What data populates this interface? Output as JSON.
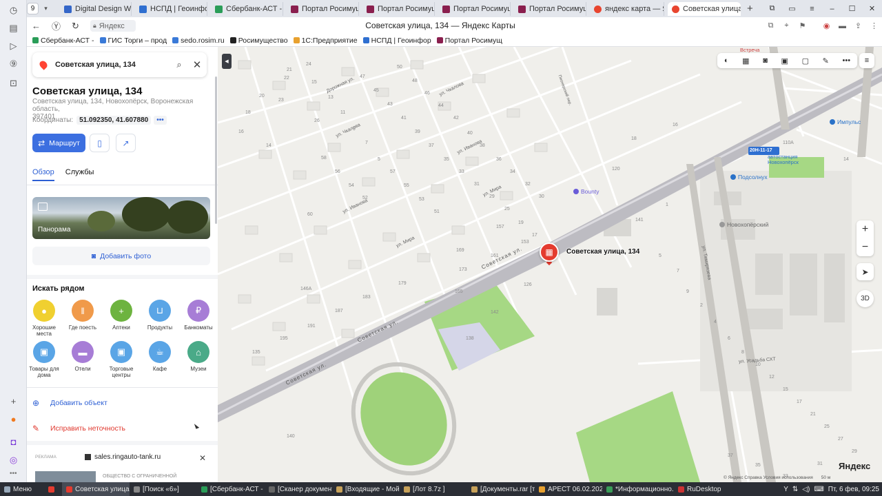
{
  "browser": {
    "tab_count": "9",
    "tabs": [
      {
        "title": "Digital Design Web С",
        "color": "#3466c8"
      },
      {
        "title": "НСПД | Геоинформ",
        "color": "#2f6fd0"
      },
      {
        "title": "Сбербанк-АСТ - Эл",
        "color": "#2a9d58"
      },
      {
        "title": "Портал Росимущес",
        "color": "#8a1f4e"
      },
      {
        "title": "Портал Росимущес",
        "color": "#8a1f4e"
      },
      {
        "title": "Портал Росимущес",
        "color": "#8a1f4e"
      },
      {
        "title": "Портал Росимущес",
        "color": "#8a1f4e"
      },
      {
        "title": "яндекс карта — Янд",
        "color": "#e8452f"
      },
      {
        "title": "Советская улица",
        "color": "#e8452f"
      }
    ],
    "url_host": "Яндекс",
    "page_title": "Советская улица, 134 — Яндекс Карты",
    "bookmarks": [
      {
        "label": "Сбербанк-АСТ -",
        "color": "#2a9d58"
      },
      {
        "label": "ГИС Торги – прод",
        "color": "#3a7ad8"
      },
      {
        "label": "sedo.rosim.ru",
        "color": "#3a7ad8"
      },
      {
        "label": "Росимущество",
        "color": "#222222"
      },
      {
        "label": "1С:Предприятие",
        "color": "#e8a12f"
      },
      {
        "label": "НСПД | Геоинфор",
        "color": "#2f6fd0"
      },
      {
        "label": "Портал Росимущ",
        "color": "#8a1f4e"
      }
    ]
  },
  "search": {
    "value": "Советская улица, 134"
  },
  "place": {
    "title": "Советская улица, 134",
    "address_line1": "Советская улица, 134, Новохопёрск, Воронежская область,",
    "address_line2": "397401",
    "coords_label": "Координаты:",
    "coords_value": "51.092350, 41.607880",
    "coords_more": "•••",
    "route_label": "Маршрут"
  },
  "tabs": {
    "overview": "Обзор",
    "services": "Службы"
  },
  "panorama_label": "Панорама",
  "add_photo_label": "Добавить фото",
  "nearby": {
    "title": "Искать рядом",
    "categories": [
      {
        "label": "Хорошие места",
        "color": "#f0d030",
        "icon": "pin-icon"
      },
      {
        "label": "Где поесть",
        "color": "#f09a4a",
        "icon": "fork-icon"
      },
      {
        "label": "Аптеки",
        "color": "#6db33f",
        "icon": "plus-icon"
      },
      {
        "label": "Продукты",
        "color": "#5aa5e6",
        "icon": "basket-icon"
      },
      {
        "label": "Банкоматы",
        "color": "#a77dd6",
        "icon": "ruble-icon"
      },
      {
        "label": "Товары для дома",
        "color": "#5aa5e6",
        "icon": "bag-icon"
      },
      {
        "label": "Отели",
        "color": "#a77dd6",
        "icon": "bed-icon"
      },
      {
        "label": "Торговые центры",
        "color": "#5aa5e6",
        "icon": "bag-icon"
      },
      {
        "label": "Кафе",
        "color": "#5aa5e6",
        "icon": "cup-icon"
      },
      {
        "label": "Музеи",
        "color": "#4aaa88",
        "icon": "museum-icon"
      }
    ]
  },
  "actions": {
    "add_object": "Добавить объект",
    "fix_error": "Исправить неточность"
  },
  "ad": {
    "label": "РЕКЛАМА",
    "site": "sales.ringauto-tank.ru",
    "text": "ОБЩЕСТВО С ОГРАНИЧЕННОЙ"
  },
  "map": {
    "marker_label": "Советская улица, 134",
    "streets": [
      {
        "name": "Советская ул.",
        "key": "s1"
      },
      {
        "name": "Советская ул.",
        "key": "s2"
      },
      {
        "name": "Советская ул.",
        "key": "s3"
      },
      {
        "name": "ул. Иванова",
        "key": "s4"
      },
      {
        "name": "ул. Иванова",
        "key": "s5"
      },
      {
        "name": "ул. Мира",
        "key": "s6"
      },
      {
        "name": "ул. Мира",
        "key": "s7"
      },
      {
        "name": "ул. Чкалова",
        "key": "s8"
      },
      {
        "name": "ул. Чкалова",
        "key": "s9"
      },
      {
        "name": "ул. Тимирязева",
        "key": "s10"
      },
      {
        "name": "ул. Усадьба СХТ",
        "key": "s11"
      },
      {
        "name": "Дорожная ул.",
        "key": "s12"
      },
      {
        "name": "Пионерский пер.",
        "key": "s13"
      }
    ],
    "pois": [
      {
        "name": "Подсолнух",
        "key": "p1"
      },
      {
        "name": "Bounty",
        "key": "p2"
      },
      {
        "name": "Новохопёрский",
        "key": "p3"
      },
      {
        "name": "Импульс",
        "key": "p4"
      },
      {
        "name": "автостанция Новохопёрск",
        "key": "p5"
      },
      {
        "name": "Встреча",
        "key": "p6"
      }
    ],
    "road_badge": "20Н-11-17",
    "logo": "Яндекс",
    "attribution": "© Яндекс  Справка  Условия использования",
    "scale": "50 м",
    "three_d": "3D",
    "house_numbers": [
      "22",
      "20",
      "18",
      "16",
      "14",
      "24",
      "21",
      "15",
      "13",
      "11",
      "9",
      "7",
      "5",
      "23",
      "50",
      "48",
      "46",
      "44",
      "42",
      "40",
      "38",
      "36",
      "34",
      "32",
      "30",
      "26",
      "47",
      "45",
      "43",
      "41",
      "39",
      "37",
      "35",
      "33",
      "31",
      "29",
      "25",
      "19",
      "17",
      "58",
      "56",
      "54",
      "52",
      "60",
      "57",
      "55",
      "53",
      "51",
      "161",
      "157",
      "153",
      "173",
      "169",
      "165",
      "179",
      "183",
      "187",
      "191",
      "195",
      "135",
      "146А",
      "140",
      "142",
      "138",
      "126",
      "141",
      "120",
      "110А",
      "14",
      "16",
      "18",
      "1",
      "3",
      "5",
      "7",
      "9",
      "2",
      "4",
      "6",
      "8",
      "10",
      "12",
      "15",
      "17",
      "21",
      "25",
      "27",
      "29",
      "31",
      "33",
      "35",
      "37"
    ]
  },
  "taskbar": {
    "start": "Меню",
    "items": [
      {
        "label": "Советская улица, ...",
        "active": true
      },
      {
        "label": "[Поиск «6»]",
        "active": false
      },
      {
        "label": "[Сбербанк-АСТ - Э...",
        "active": false
      },
      {
        "label": "[Сканер документ...",
        "active": false
      },
      {
        "label": "[Входящие - Мой...",
        "active": false
      },
      {
        "label": "[Лот 8.7z ]",
        "active": false
      },
      {
        "label": "[Документы.rar [т...",
        "active": false
      },
      {
        "label": "АРЕСТ 06.02.2026",
        "active": false
      },
      {
        "label": "*Информационно...",
        "active": false
      },
      {
        "label": "RuDesktop",
        "active": false
      }
    ],
    "clock": "Пт, 6 фев, 09:25"
  }
}
